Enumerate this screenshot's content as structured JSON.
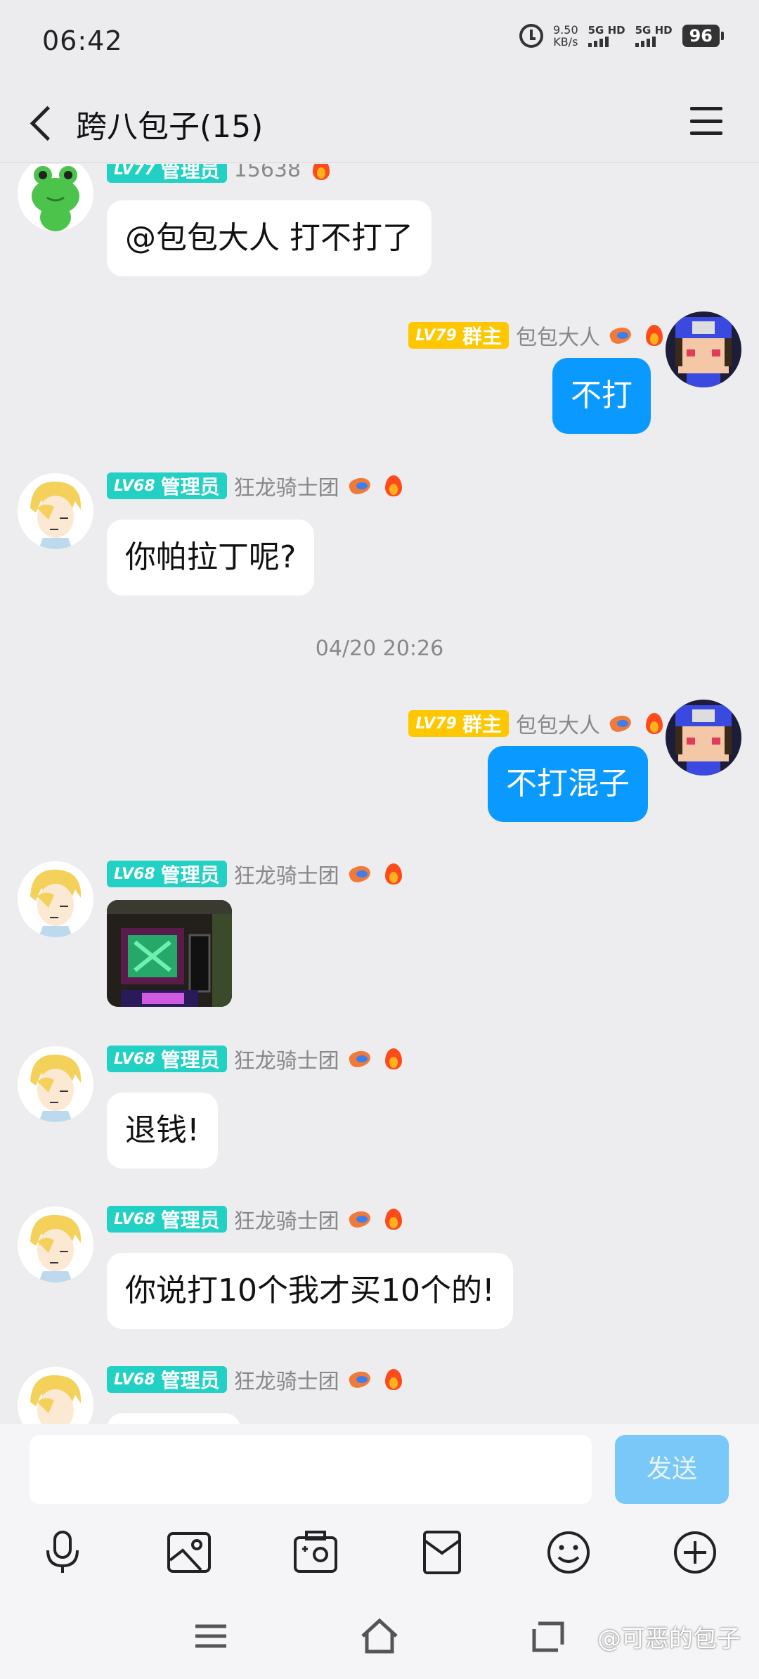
{
  "status_bar": {
    "time": "06:42",
    "net_speed_value": "9.50",
    "net_speed_unit": "KB/s",
    "sim1": "5G HD",
    "sim2": "5G HD",
    "battery": "96"
  },
  "header": {
    "title": "跨八包子(15)"
  },
  "messages": [
    {
      "sender": "15638",
      "level": "LV77",
      "role": "管理员",
      "text": "@包包大人 打不打了"
    },
    {
      "sender": "包包大人",
      "level": "LV79",
      "role": "群主",
      "text": "不打"
    },
    {
      "sender": "狂龙骑士团",
      "level": "LV68",
      "role": "管理员",
      "text": "你帕拉丁呢?"
    },
    {
      "timestamp": "04/20 20:26"
    },
    {
      "sender": "包包大人",
      "level": "LV79",
      "role": "群主",
      "text": "不打混子"
    },
    {
      "sender": "狂龙骑士团",
      "level": "LV68",
      "role": "管理员",
      "image": true
    },
    {
      "sender": "狂龙骑士团",
      "level": "LV68",
      "role": "管理员",
      "text": "退钱!"
    },
    {
      "sender": "狂龙骑士团",
      "level": "LV68",
      "role": "管理员",
      "text": "你说打10个我才买10个的!"
    },
    {
      "sender": "狂龙骑士团",
      "level": "LV68",
      "role": "管理员"
    }
  ],
  "input": {
    "value": "",
    "send_label": "发送"
  },
  "toolbar": [
    "microphone-icon",
    "image-icon",
    "camera-icon",
    "red-packet-icon",
    "emoji-icon",
    "plus-icon"
  ],
  "watermark": "@可恶的包子",
  "colors": {
    "admin_badge": "#23d0c4",
    "owner_badge": "#ffc700",
    "outgoing_bubble": "#0a99ff",
    "send_button": "#7ac8f8"
  }
}
